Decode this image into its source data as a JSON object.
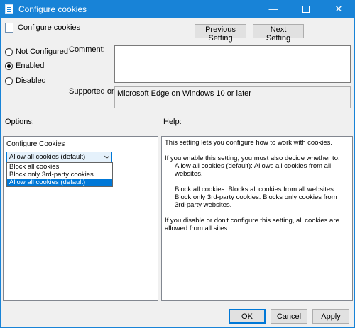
{
  "window": {
    "title": "Configure cookies"
  },
  "header": {
    "title": "Configure cookies",
    "previous_label": "Previous Setting",
    "next_label": "Next Setting"
  },
  "state": {
    "options": [
      "Not Configured",
      "Enabled",
      "Disabled"
    ],
    "selected": "Enabled"
  },
  "comment": {
    "label": "Comment:",
    "value": ""
  },
  "supported": {
    "label": "Supported on:",
    "value": "Microsoft Edge on Windows 10 or later"
  },
  "options_section": {
    "label": "Options:",
    "field_label": "Configure Cookies",
    "selected_value": "Allow all cookies (default)",
    "dropdown_items": [
      "Block all cookies",
      "Block only 3rd-party cookies",
      "Allow all cookies (default)"
    ],
    "highlighted_index": 2
  },
  "help_section": {
    "label": "Help:",
    "intro": "This setting lets you configure how to work with cookies.",
    "enable_line": "If you enable this setting, you must also decide whether to:",
    "allow_line": "Allow all cookies (default): Allows all cookies from all websites.",
    "block_all_line": "Block all cookies: Blocks all cookies from all websites.",
    "block_3rd_line": "Block only 3rd-party cookies: Blocks only cookies from 3rd-party websites.",
    "disable_line": "If you disable or don't configure this setting, all cookies are allowed from all sites."
  },
  "footer": {
    "ok_label": "OK",
    "cancel_label": "Cancel",
    "apply_label": "Apply"
  },
  "colors": {
    "titlebar": "#1883d7",
    "selection": "#0078d7"
  }
}
